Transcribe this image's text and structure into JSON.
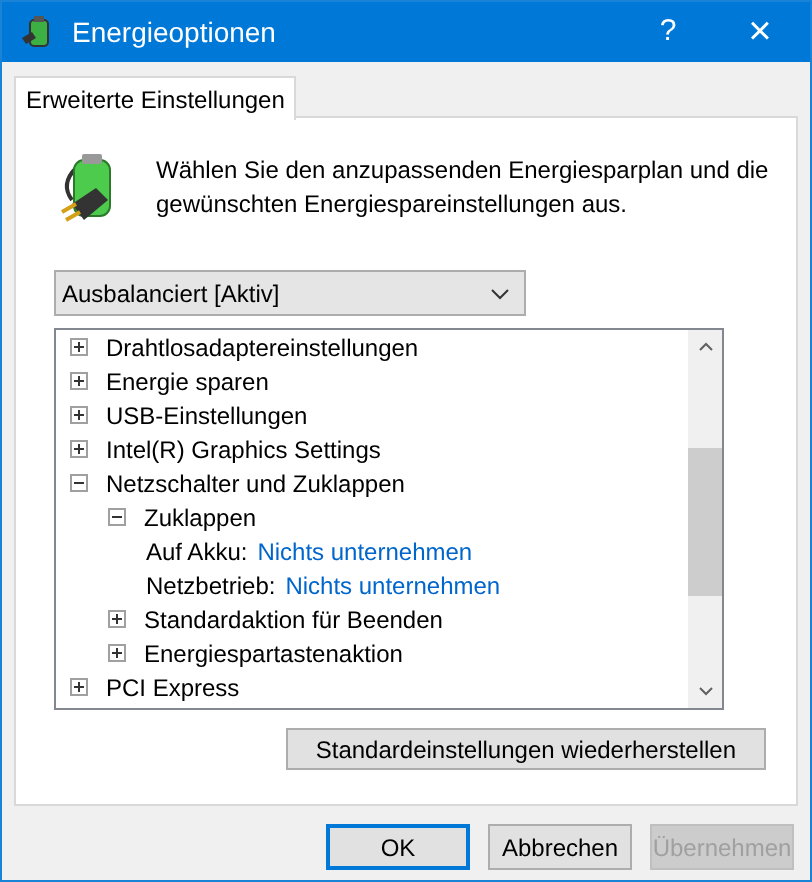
{
  "window": {
    "title": "Energieoptionen",
    "help": "?",
    "close": "×"
  },
  "tabs": [
    {
      "label": "Erweiterte Einstellungen",
      "selected": true
    }
  ],
  "intro": "Wählen Sie den anzupassenden Energiesparplan und die gewünschten Energiespareinstellungen aus.",
  "plan_dropdown": {
    "value": "Ausbalanciert [Aktiv]"
  },
  "tree": [
    {
      "kind": "group",
      "label": "Drahtlosadaptereinstellungen",
      "expanded": false
    },
    {
      "kind": "group",
      "label": "Energie sparen",
      "expanded": false
    },
    {
      "kind": "group",
      "label": "USB-Einstellungen",
      "expanded": false
    },
    {
      "kind": "group",
      "label": "Intel(R) Graphics Settings",
      "expanded": false
    },
    {
      "kind": "group",
      "label": "Netzschalter und Zuklappen",
      "expanded": true,
      "children": [
        {
          "kind": "group",
          "label": "Zuklappen",
          "expanded": true,
          "children": [
            {
              "kind": "setting",
              "label": "Auf Akku:",
              "value": "Nichts unternehmen"
            },
            {
              "kind": "setting",
              "label": "Netzbetrieb:",
              "value": "Nichts unternehmen"
            }
          ]
        },
        {
          "kind": "group",
          "label": "Standardaktion für Beenden",
          "expanded": false
        },
        {
          "kind": "group",
          "label": "Energiespartastenaktion",
          "expanded": false
        }
      ]
    },
    {
      "kind": "group",
      "label": "PCI Express",
      "expanded": false
    }
  ],
  "restore_button": {
    "label": "Standardeinstellungen wiederherstellen"
  },
  "buttons": [
    {
      "label": "OK",
      "default": true,
      "disabled": false
    },
    {
      "label": "Abbrechen",
      "default": false,
      "disabled": false
    },
    {
      "label": "Übernehmen",
      "default": false,
      "disabled": true
    }
  ]
}
